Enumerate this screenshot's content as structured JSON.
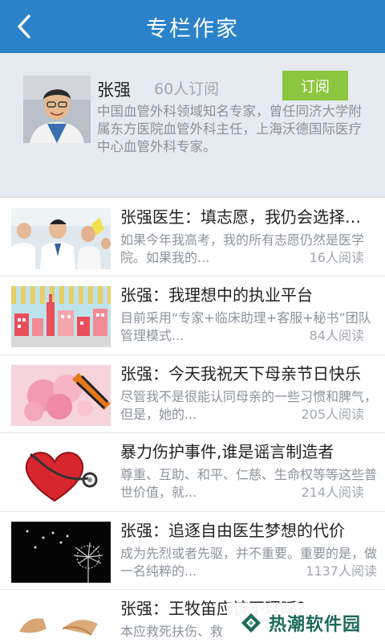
{
  "header": {
    "title": "专栏作家",
    "back_icon": "back-arrow-icon"
  },
  "author": {
    "name": "张强",
    "subscribers": "60人订阅",
    "subscribe_label": "订阅",
    "description": "中国血管外科领域知名专家，曾任同济大学附属东方医院血管外科主任，上海沃德国际医疗中心血管外科专家。",
    "subscribe_color": "#8cc63f"
  },
  "articles": [
    {
      "title": "张强医生：填志愿，我仍会选择医学院",
      "excerpt": "如果今年我高考，我的所有志愿仍然是医学院。如果我的...",
      "reads": "16人阅读",
      "thumb": "doctors-lab-photo"
    },
    {
      "title": "张强：我理想中的执业平台",
      "excerpt": "目前采用“专家+临床助理+客服+秘书”团队管理模式...",
      "reads": "84人阅读",
      "thumb": "city-illustration"
    },
    {
      "title": "张强：今天我祝天下母亲节日快乐",
      "excerpt": "尽管我不是很能认同母亲的一些习惯和脾气，但是，她的...",
      "reads": "205人阅读",
      "thumb": "carnation-flowers"
    },
    {
      "title": "暴力伤护事件,谁是谣言制造者",
      "excerpt": "尊重、互助、和平、仁慈、生命权等等这些普世价值，就...",
      "reads": "214人阅读",
      "thumb": "heart-stethoscope"
    },
    {
      "title": "张强：追逐自由医生梦想的代价",
      "excerpt": "成为先烈或者先驱，并不重要。重要的是，做一名纯粹的...",
      "reads": "1137人阅读",
      "thumb": "dandelion"
    },
    {
      "title": "张强：王牧笛应该不理睬？",
      "excerpt": "本应救死扶伤、救",
      "reads": "",
      "thumb": "eggshell"
    }
  ],
  "watermark": {
    "text": "热潮软件园",
    "logo_color": "#1d6a5a"
  }
}
